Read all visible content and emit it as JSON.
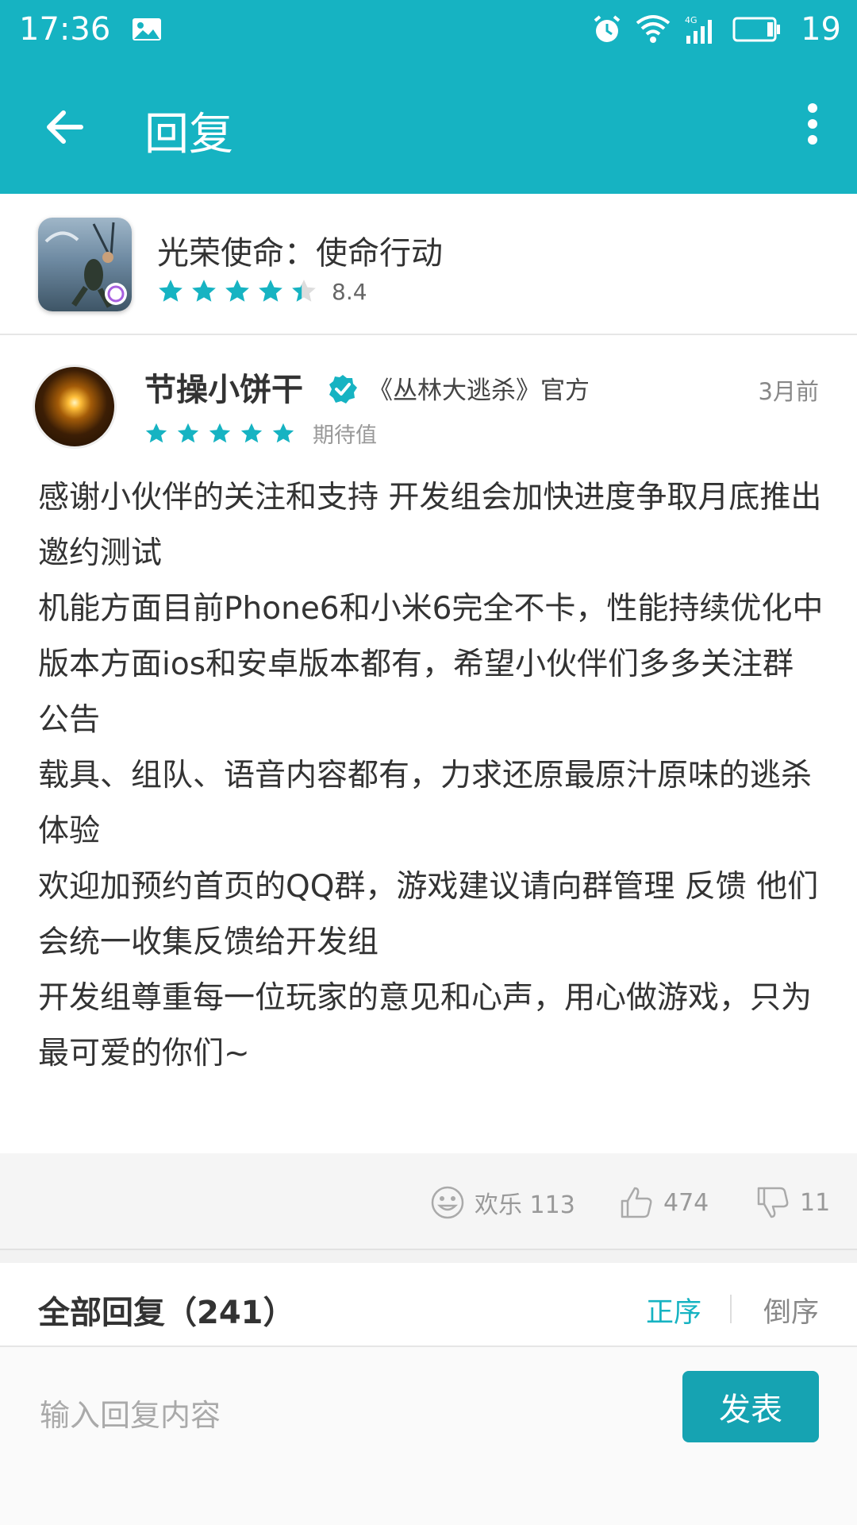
{
  "status_bar": {
    "time": "17:36",
    "battery": "19",
    "icons": [
      "gallery-icon",
      "alarm-icon",
      "wifi-icon",
      "signal-4g-icon",
      "battery-icon"
    ]
  },
  "app_bar": {
    "title": "回复",
    "back_icon": "arrow-left-icon",
    "menu_icon": "more-vertical-icon"
  },
  "game": {
    "name": "光荣使命：使命行动",
    "rating": "8.4",
    "stars": 4.3
  },
  "comment": {
    "username": "节操小饼干",
    "tag": "《丛林大逃杀》官方",
    "time_ago": "3月前",
    "stars": 5,
    "rating_label": "期待值",
    "body": [
      "感谢小伙伴的关注和支持 开发组会加快进度争取月底推出邀约测试",
      "机能方面目前Phone6和小米6完全不卡，性能持续优化中",
      "版本方面ios和安卓版本都有，希望小伙伴们多多关注群公告",
      "载具、组队、语音内容都有，力求还原最原汁原味的逃杀体验",
      "欢迎加预约首页的QQ群，游戏建议请向群管理 反馈 他们会统一收集反馈给开发组",
      "开发组尊重每一位玩家的意见和心声，用心做游戏，只为最可爱的你们~"
    ]
  },
  "actions": {
    "fun_label": "欢乐 113",
    "like_count": "474",
    "dislike_count": "11"
  },
  "replies": {
    "title": "全部回复（241）",
    "sort_asc": "正序",
    "sort_desc": "倒序"
  },
  "composer": {
    "placeholder": "输入回复内容",
    "value": "",
    "send_label": "发表"
  },
  "colors": {
    "accent": "#16b3c2",
    "button": "#16a3b2",
    "star_empty": "#dddddd"
  }
}
